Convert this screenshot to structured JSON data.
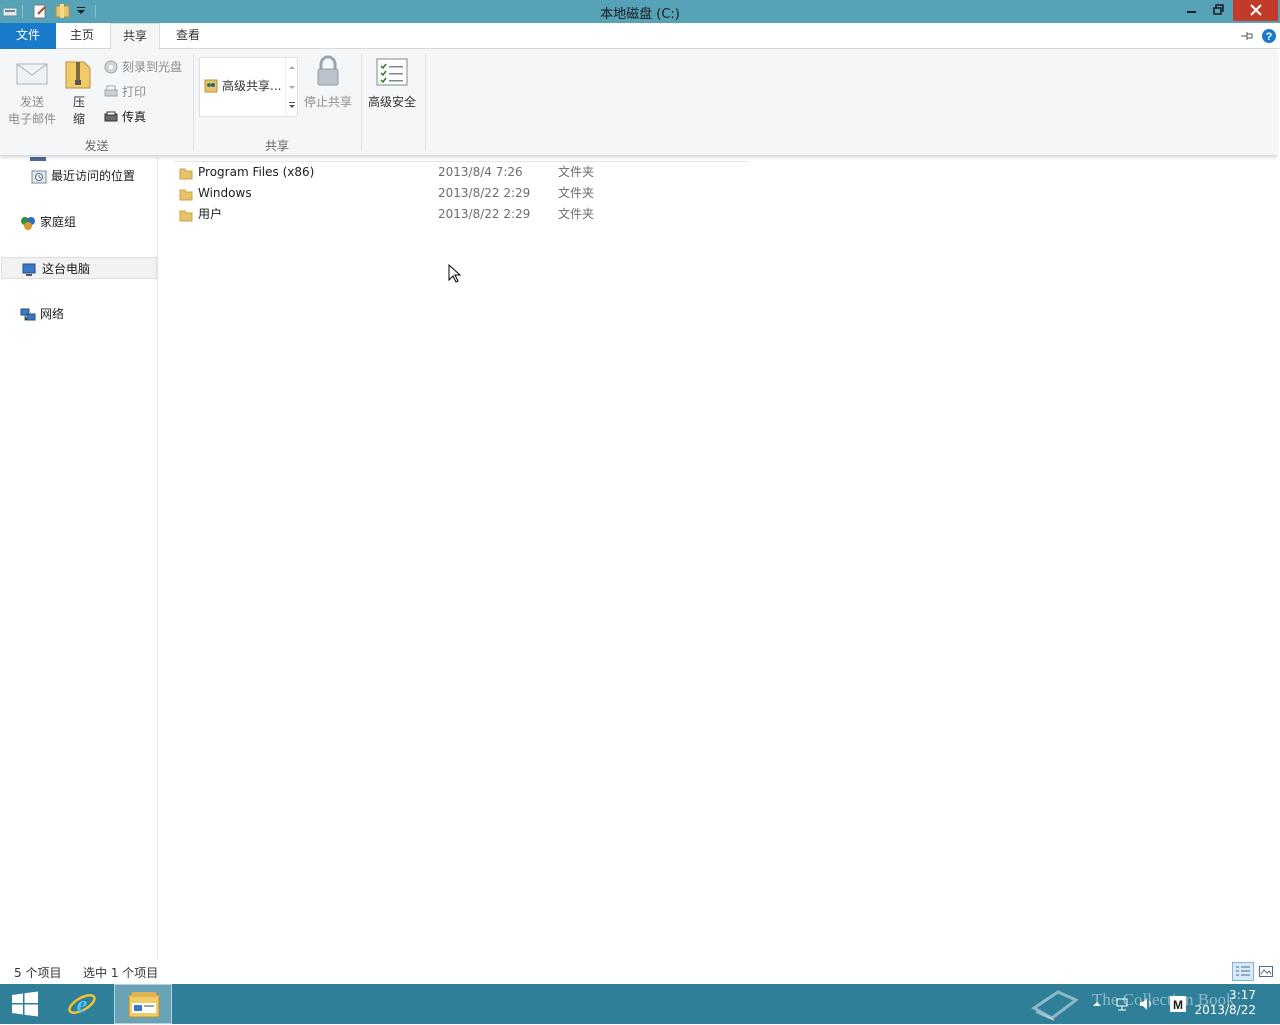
{
  "window": {
    "title": "本地磁盘 (C:)"
  },
  "ribbon": {
    "tabs": [
      "文件",
      "主页",
      "共享",
      "查看"
    ],
    "send_group": {
      "label": "发送",
      "email_line1": "发送",
      "email_line2": "电子邮件",
      "zip_line1": "压",
      "zip_line2": "缩",
      "burn": "刻录到光盘",
      "print": "打印",
      "fax": "传真"
    },
    "share_group": {
      "label": "共享",
      "share_with": "高级共享...",
      "stop_sharing": "停止共享"
    },
    "advanced_security": "高级安全"
  },
  "nav": {
    "recent": "最近访问的位置",
    "homegroup": "家庭组",
    "thispc": "这台电脑",
    "network": "网络"
  },
  "files": [
    {
      "name": "Program Files (x86)",
      "date": "2013/8/4 7:26",
      "type": "文件夹"
    },
    {
      "name": "Windows",
      "date": "2013/8/22 2:29",
      "type": "文件夹"
    },
    {
      "name": "用户",
      "date": "2013/8/22 2:29",
      "type": "文件夹"
    }
  ],
  "status": {
    "item_count": "5 个项目",
    "selected": "选中 1 个项目"
  },
  "taskbar": {
    "time": "3:17",
    "date": "2013/8/22",
    "watermark": "The Collection Book"
  },
  "colors": {
    "titlebar": "#56a2b7",
    "file_tab": "#1979ca",
    "taskbar": "#2f7f99",
    "folder": "#e8c36a",
    "close": "#c23b28"
  }
}
